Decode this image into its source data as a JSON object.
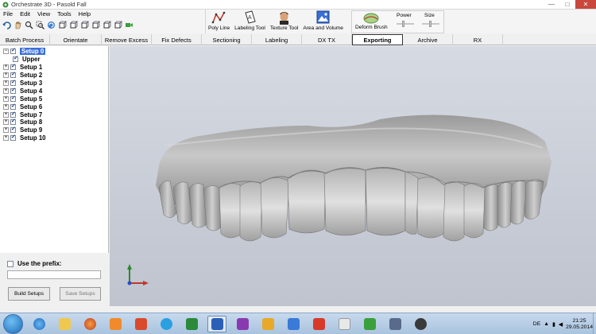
{
  "window": {
    "title": "Orchestrate 3D - Pasold Fall",
    "controls": [
      "—",
      "□",
      "✕"
    ]
  },
  "menu": [
    "File",
    "Edit",
    "View",
    "Tools",
    "Help"
  ],
  "toolbar_icons": [
    "undo-icon",
    "hand-icon",
    "zoom-icon",
    "zoom-region-icon",
    "rotate-icon",
    "view-cube-1-icon",
    "view-cube-2-icon",
    "view-cube-3-icon",
    "view-cube-4-icon",
    "view-cube-5-icon",
    "view-cube-6-icon",
    "camera-icon"
  ],
  "ribbon": {
    "poly_line": "Poly Line",
    "labeling_tool": "Labeling Tool",
    "texture_tool": "Texture Tool",
    "area_volume": "Area and Volume",
    "deform_brush": "Deform Brush",
    "power": "Power",
    "size": "Size"
  },
  "tabs": [
    "Batch Process",
    "Orientate",
    "Remove Excess",
    "Fix Defects",
    "Sectioning",
    "Labeling",
    "DX TX",
    "Exporting",
    "Archive",
    "RX"
  ],
  "active_tab": "Exporting",
  "tree": [
    {
      "label": "Setup 0",
      "level": 0,
      "selected": true
    },
    {
      "label": "Upper",
      "level": 1
    },
    {
      "label": "Setup 1",
      "level": 0
    },
    {
      "label": "Setup 2",
      "level": 0
    },
    {
      "label": "Setup 3",
      "level": 0
    },
    {
      "label": "Setup 4",
      "level": 0
    },
    {
      "label": "Setup 5",
      "level": 0
    },
    {
      "label": "Setup 6",
      "level": 0
    },
    {
      "label": "Setup 7",
      "level": 0
    },
    {
      "label": "Setup 8",
      "level": 0
    },
    {
      "label": "Setup 9",
      "level": 0
    },
    {
      "label": "Setup 10",
      "level": 0
    }
  ],
  "prefix": {
    "label": "Use the prefix:",
    "value": ""
  },
  "buttons": {
    "build": "Build Setups",
    "save": "Save Setups"
  },
  "taskbar": {
    "apps": [
      "ie-icon",
      "explorer-folder-icon",
      "firefox-icon",
      "media-player-icon",
      "powerpoint-icon",
      "skype-icon",
      "excel-icon",
      "word-icon",
      "onenote-icon",
      "outlook-icon",
      "windows-app-icon",
      "pdf-icon",
      "dental-app-icon",
      "qt-app-icon",
      "pen-app-icon",
      "orchestrate-icon"
    ],
    "active_app": "word-icon",
    "lang": "DE",
    "time": "21:25",
    "date": "29.05.2014"
  }
}
